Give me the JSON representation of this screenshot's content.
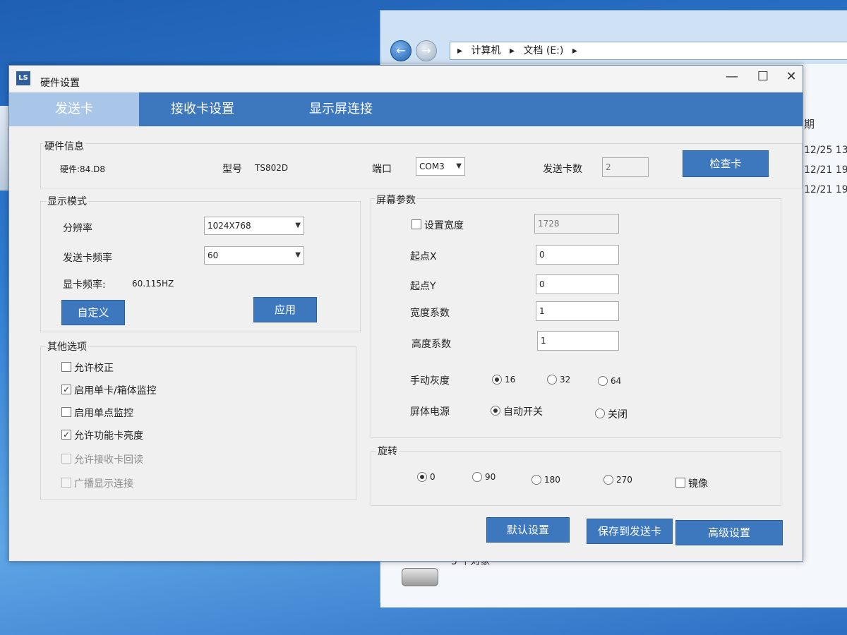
{
  "explorer": {
    "breadcrumb": [
      "计算机",
      "文档 (E:)"
    ],
    "column_header": "期",
    "dates": [
      "12/25 13",
      "12/21 19",
      "12/21 19"
    ],
    "status": "5 个对象"
  },
  "dialog": {
    "title": "硬件设置",
    "app_icon_text": "LS",
    "controls": {
      "minimize": "—",
      "maximize": "☐",
      "close": "✕"
    },
    "tabs": [
      {
        "label": "发送卡",
        "active": true
      },
      {
        "label": "接收卡设置",
        "active": false
      },
      {
        "label": "显示屏连接",
        "active": false
      }
    ],
    "hardware_info": {
      "title": "硬件信息",
      "hardware": "硬件:84.D8",
      "model_label": "型号",
      "model_value": "TS802D",
      "port_label": "端口",
      "port_value": "COM3",
      "card_count_label": "发送卡数",
      "card_count_value": "2",
      "check_button": "检查卡"
    },
    "display_mode": {
      "title": "显示模式",
      "resolution_label": "分辨率",
      "resolution_value": "1024X768",
      "frequency_label": "发送卡频率",
      "frequency_value": "60",
      "gpu_freq_label": "显卡频率:",
      "gpu_freq_value": "60.115HZ",
      "custom_button": "自定义",
      "apply_button": "应用"
    },
    "other_options": {
      "title": "其他选项",
      "items": [
        {
          "label": "允许校正",
          "checked": false,
          "enabled": true
        },
        {
          "label": "启用单卡/箱体监控",
          "checked": true,
          "enabled": true
        },
        {
          "label": "启用单点监控",
          "checked": false,
          "enabled": true
        },
        {
          "label": "允许功能卡亮度",
          "checked": true,
          "enabled": true
        },
        {
          "label": "允许接收卡回读",
          "checked": false,
          "enabled": false
        },
        {
          "label": "广播显示连接",
          "checked": false,
          "enabled": false
        }
      ]
    },
    "screen_params": {
      "title": "屏幕参数",
      "set_width_label": "设置宽度",
      "set_width_checked": false,
      "width_value": "1728",
      "start_x_label": "起点X",
      "start_x_value": "0",
      "start_y_label": "起点Y",
      "start_y_value": "0",
      "width_coef_label": "宽度系数",
      "width_coef_value": "1",
      "height_coef_label": "高度系数",
      "height_coef_value": "1",
      "gray_label": "手动灰度",
      "gray_options": [
        "16",
        "32",
        "64"
      ],
      "gray_selected": "16",
      "power_label": "屏体电源",
      "power_options": [
        "自动开关",
        "关闭"
      ],
      "power_selected": "自动开关"
    },
    "rotation": {
      "title": "旋转",
      "options": [
        "0",
        "90",
        "180",
        "270"
      ],
      "selected": "0",
      "mirror_label": "镜像",
      "mirror_checked": false
    },
    "footer": {
      "default_button": "默认设置",
      "save_button": "保存到发送卡",
      "advanced_button": "高级设置"
    }
  }
}
